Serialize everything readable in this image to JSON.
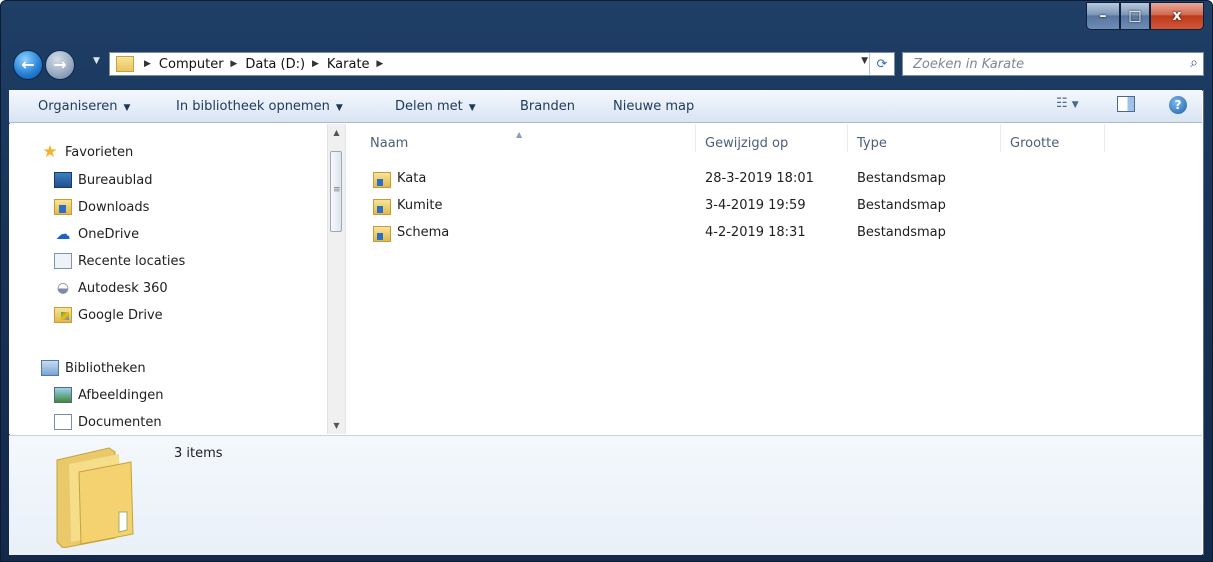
{
  "window": {
    "caption_buttons": {
      "minimize": "–",
      "maximize": "□",
      "close": "x"
    }
  },
  "address": {
    "crumbs": [
      "Computer",
      "Data (D:)",
      "Karate"
    ]
  },
  "search": {
    "placeholder": "Zoeken in Karate"
  },
  "toolbar": {
    "organize": "Organiseren",
    "include_library": "In bibliotheek opnemen",
    "share": "Delen met",
    "burn": "Branden",
    "new_folder": "Nieuwe map"
  },
  "navpane": {
    "favorites": {
      "label": "Favorieten",
      "items": [
        "Bureaublad",
        "Downloads",
        "OneDrive",
        "Recente locaties",
        "Autodesk 360",
        "Google Drive"
      ]
    },
    "libraries": {
      "label": "Bibliotheken",
      "items": [
        "Afbeeldingen",
        "Documenten"
      ]
    }
  },
  "filelist": {
    "columns": [
      "Naam",
      "Gewijzigd op",
      "Type",
      "Grootte"
    ],
    "rows": [
      {
        "name": "Kata",
        "modified": "28-3-2019 18:01",
        "type": "Bestandsmap",
        "size": ""
      },
      {
        "name": "Kumite",
        "modified": "3-4-2019 19:59",
        "type": "Bestandsmap",
        "size": ""
      },
      {
        "name": "Schema",
        "modified": "4-2-2019 18:31",
        "type": "Bestandsmap",
        "size": ""
      }
    ]
  },
  "details": {
    "count": "3 items"
  },
  "colors": {
    "accent": "#1e395b",
    "titlebar": "#1f3f66",
    "close": "#c8452a"
  }
}
